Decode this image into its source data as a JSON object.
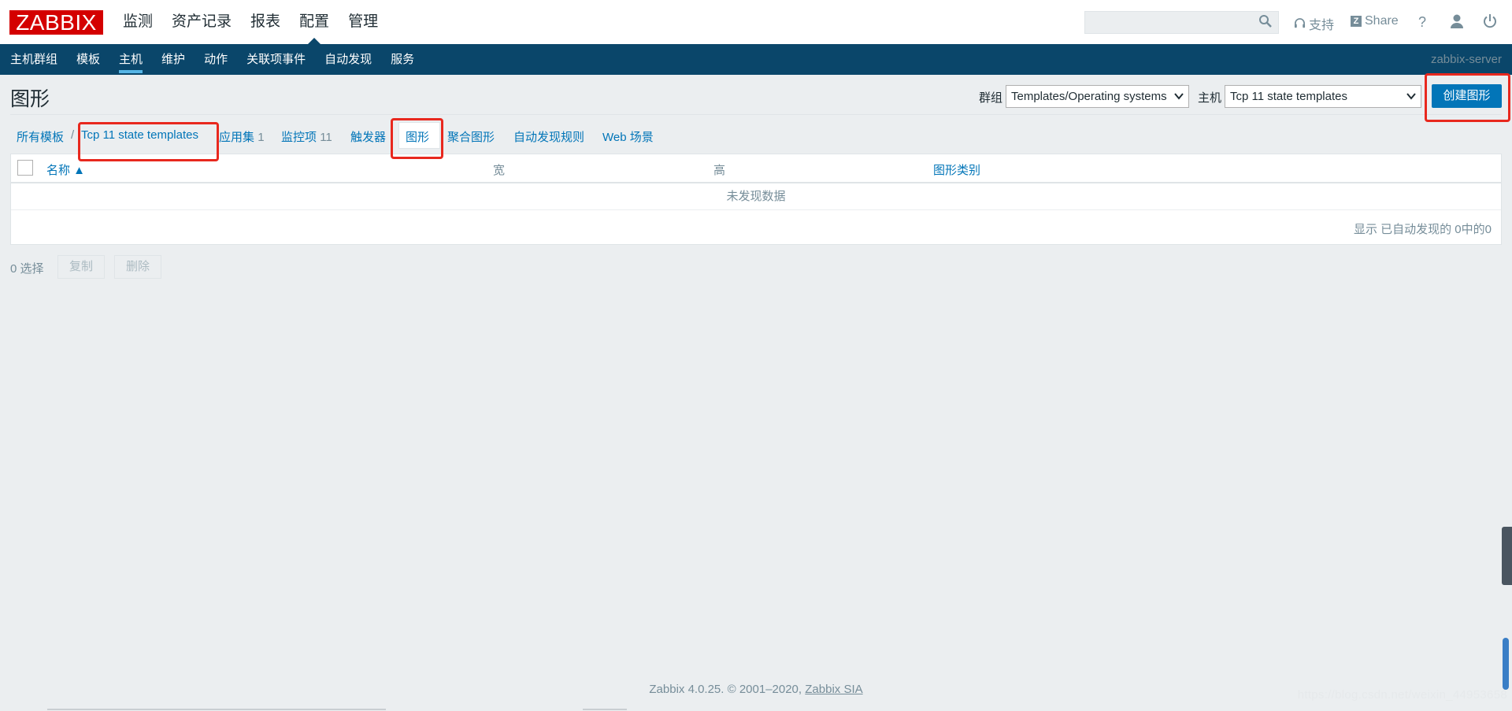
{
  "header": {
    "logo": "ZABBIX",
    "nav": [
      "监测",
      "资产记录",
      "报表",
      "配置",
      "管理"
    ],
    "active_nav": "配置",
    "support": "支持",
    "share": "Share",
    "help": "?",
    "search": {
      "value": "",
      "placeholder": ""
    }
  },
  "subnav": {
    "items": [
      "主机群组",
      "模板",
      "主机",
      "维护",
      "动作",
      "关联项事件",
      "自动发现",
      "服务"
    ],
    "active": "主机",
    "server": "zabbix-server"
  },
  "page": {
    "title": "图形",
    "group_label": "群组",
    "group_value": "Templates/Operating systems",
    "host_label": "主机",
    "host_value": "Tcp 11 state templates",
    "create_button": "创建图形"
  },
  "breadcrumbs": {
    "all_templates": "所有模板",
    "separator": "/",
    "template": "Tcp 11 state templates",
    "applications": "应用集",
    "applications_count": "1",
    "items": "监控项",
    "items_count": "11",
    "triggers": "触发器",
    "graphs": "图形",
    "screens": "聚合图形",
    "discovery": "自动发现规则",
    "web": "Web 场景"
  },
  "table": {
    "columns": [
      "名称 ▲",
      "宽",
      "高",
      "图形类别"
    ],
    "empty_text": "未发现数据",
    "paging_text": "显示 已自动发现的 0中的0"
  },
  "actions": {
    "selected": "0 选择",
    "copy": "复制",
    "delete": "删除"
  },
  "footer": {
    "text": "Zabbix 4.0.25. © 2001–2020, ",
    "link": "Zabbix SIA",
    "watermark": "https://blog.csdn.net/weixin_44953658"
  },
  "colors": {
    "logo_red": "#d40000",
    "nav_bg": "#0a466a",
    "link_blue": "#0275b8",
    "annotation_red": "#e8281e"
  }
}
